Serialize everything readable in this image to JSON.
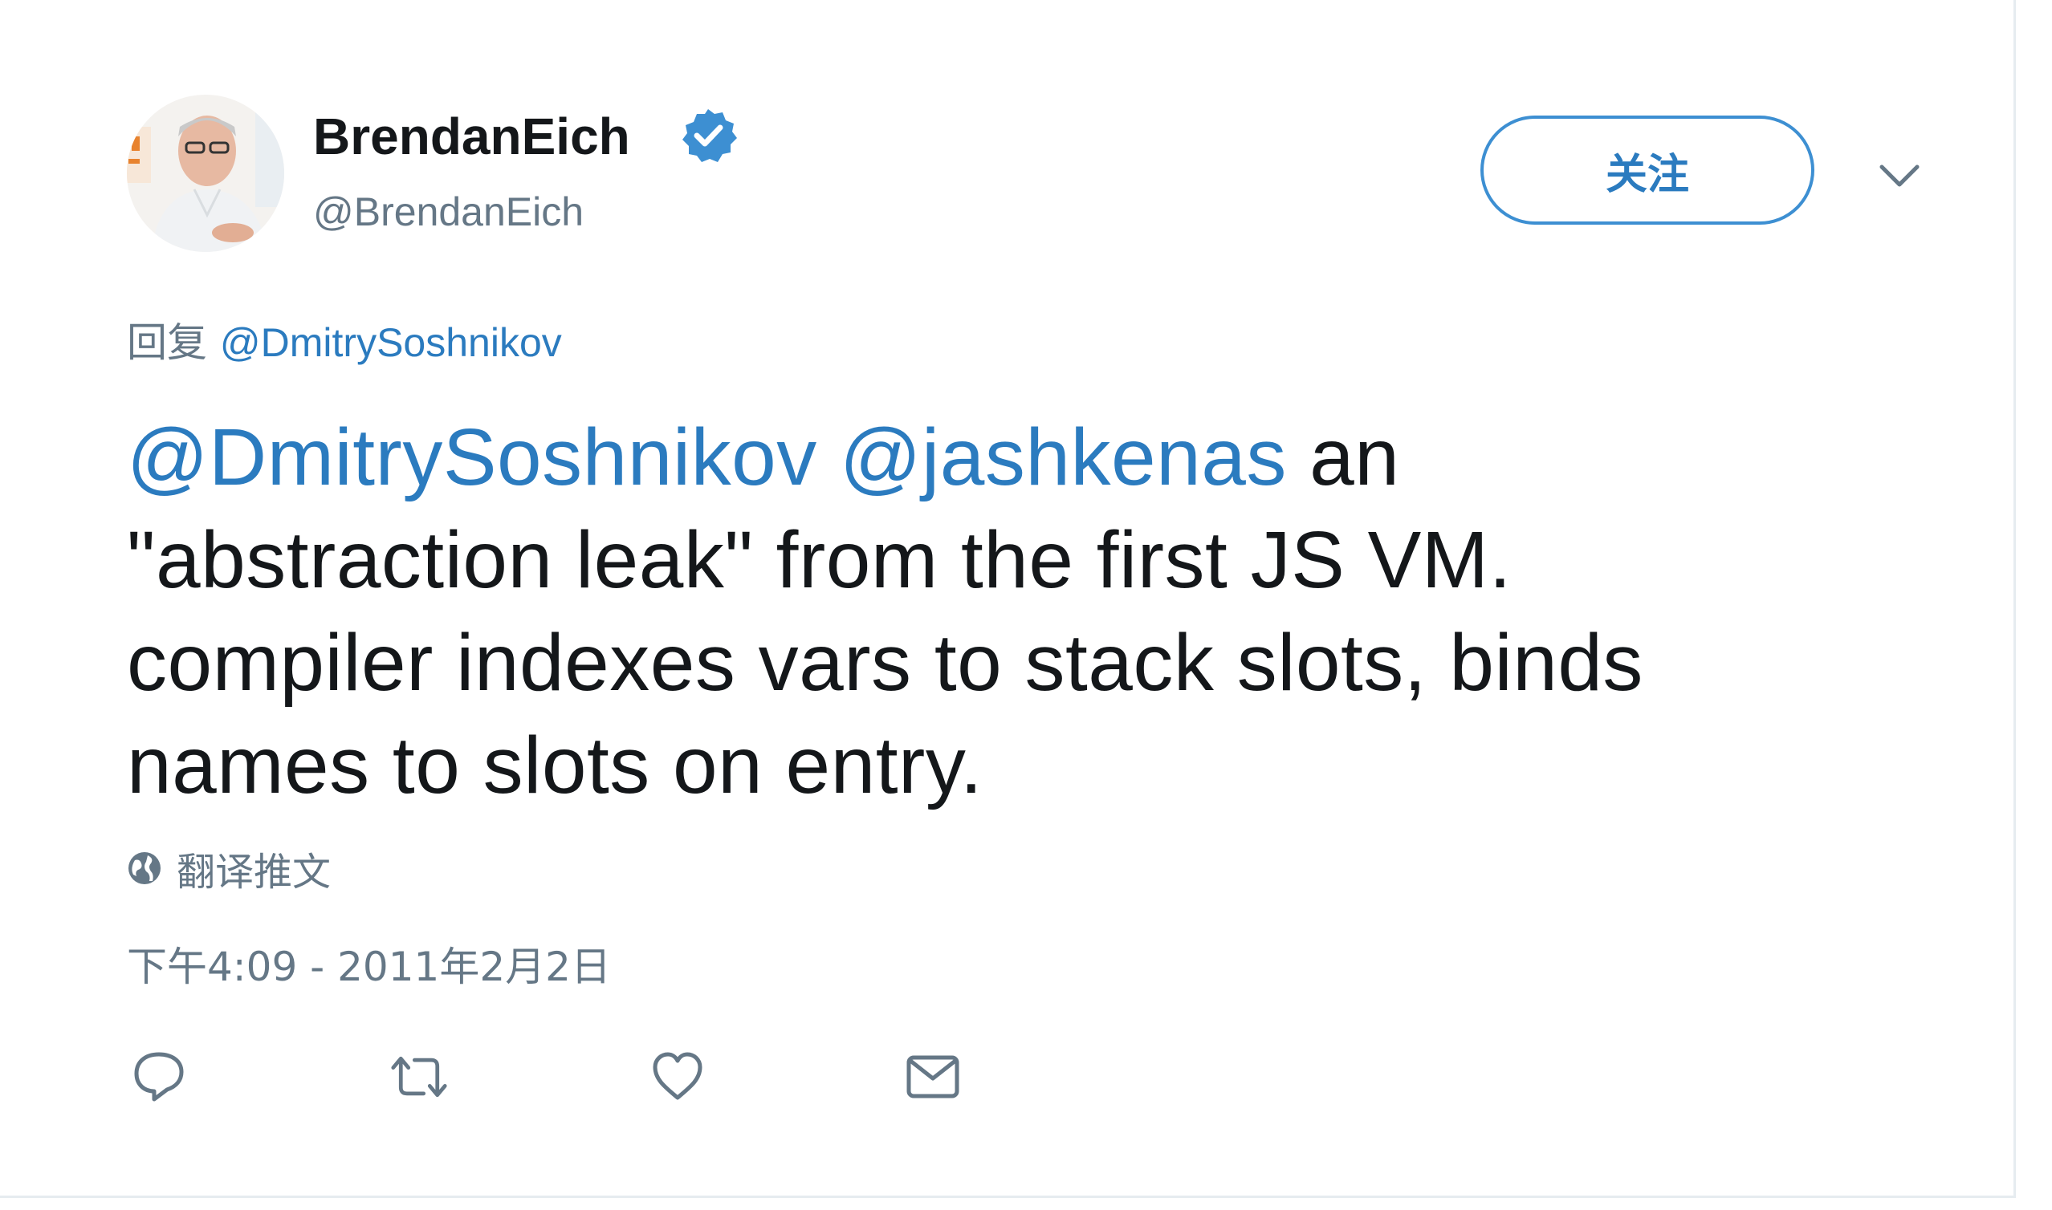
{
  "user": {
    "display_name": "BrendanEich",
    "handle": "@BrendanEich",
    "verified": true
  },
  "follow_button": {
    "label": "关注"
  },
  "reply_context": {
    "prefix": "回复",
    "mention": "@DmitrySoshnikov"
  },
  "tweet": {
    "mention_1": "@DmitrySoshnikov",
    "mention_2": "@jashkenas",
    "text_part_1": " an",
    "text_part_2": "\"abstraction leak\" from the first JS VM.",
    "text_part_3": "compiler indexes vars to stack slots, binds",
    "text_part_4": "names to slots on entry."
  },
  "translate": {
    "label": "翻译推文"
  },
  "timestamp": "下午4:09 - 2011年2月2日",
  "actions": [
    {
      "name": "reply",
      "icon": "reply-icon"
    },
    {
      "name": "retweet",
      "icon": "retweet-icon"
    },
    {
      "name": "like",
      "icon": "heart-icon"
    },
    {
      "name": "message",
      "icon": "envelope-icon"
    }
  ],
  "colors": {
    "link": "#2b7bbf",
    "secondary_text": "#657786",
    "primary_text": "#14171a",
    "verified": "#3d8fd2"
  }
}
